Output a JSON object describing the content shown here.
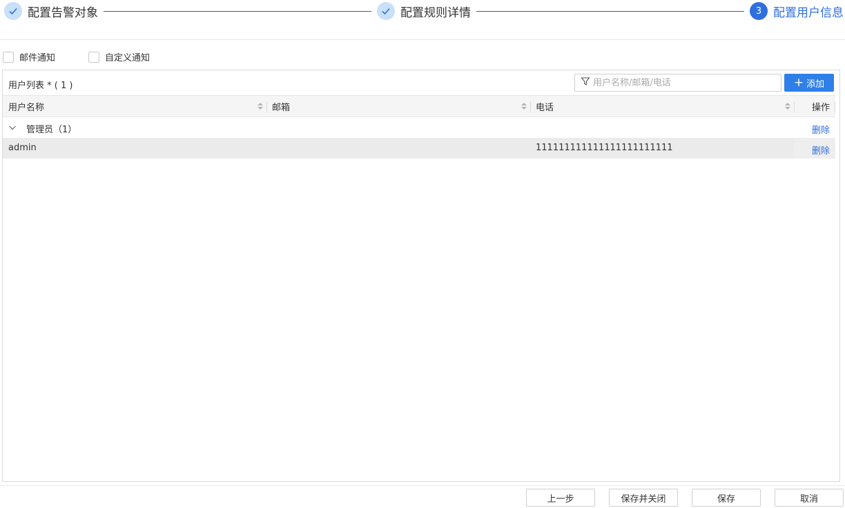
{
  "steps": [
    {
      "label": "配置告警对象",
      "state": "done"
    },
    {
      "label": "配置规则详情",
      "state": "done"
    },
    {
      "label": "配置用户信息",
      "state": "active",
      "number": "3"
    }
  ],
  "notify": {
    "email_label": "邮件通知",
    "custom_label": "自定义通知"
  },
  "panel": {
    "title": "用户列表 * ( 1 )",
    "filter_placeholder": "用户名称/邮箱/电话",
    "add_label": "添加"
  },
  "table": {
    "columns": [
      "用户名称",
      "邮箱",
      "电话",
      "操作"
    ],
    "group": {
      "title": "管理员（1）",
      "action": "删除"
    },
    "rows": [
      {
        "name": "admin",
        "email": "",
        "phone": "111111111111111111111111",
        "action": "删除"
      }
    ]
  },
  "footer": {
    "prev": "上一步",
    "save_close": "保存并关闭",
    "save": "保存",
    "cancel": "取消"
  },
  "colors": {
    "primary": "#2f6fe0",
    "done_circle": "#c9dffa",
    "button_blue": "#2f7fe8"
  }
}
